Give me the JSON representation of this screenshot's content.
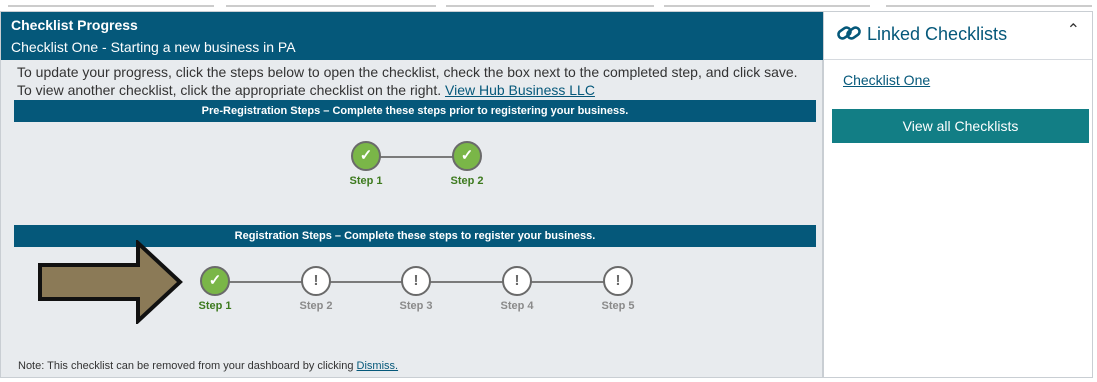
{
  "checklist_progress": {
    "title": "Checklist Progress",
    "subtitle": "Checklist One - Starting a new business in PA",
    "instructions_text": "To update your progress, click the steps below to open the checklist, check the box next to the completed step, and click save. To view another checklist, click the appropriate checklist on the right.",
    "instructions_link": "View Hub Business LLC",
    "pre_registration": {
      "heading": "Pre-Registration Steps – Complete these steps prior to registering your business.",
      "steps": [
        {
          "label": "Step 1",
          "status": "complete"
        },
        {
          "label": "Step 2",
          "status": "complete"
        }
      ]
    },
    "registration": {
      "heading": "Registration Steps – Complete these steps to register your business.",
      "steps": [
        {
          "label": "Step 1",
          "status": "complete"
        },
        {
          "label": "Step 2",
          "status": "incomplete"
        },
        {
          "label": "Step 3",
          "status": "incomplete"
        },
        {
          "label": "Step 4",
          "status": "incomplete"
        },
        {
          "label": "Step 5",
          "status": "incomplete"
        }
      ]
    },
    "note_text": "Note: This checklist can be removed from your dashboard by clicking",
    "note_link": "Dismiss."
  },
  "linked_checklists": {
    "title": "Linked Checklists",
    "items": [
      "Checklist One"
    ],
    "view_all_label": "View all Checklists"
  },
  "icons": {
    "complete": "✓",
    "incomplete": "!",
    "collapse": "⌃",
    "link": "link-icon"
  },
  "colors": {
    "header": "#05587a",
    "complete": "#7ab648",
    "button": "#127e85",
    "arrow": "#8b7a57"
  }
}
